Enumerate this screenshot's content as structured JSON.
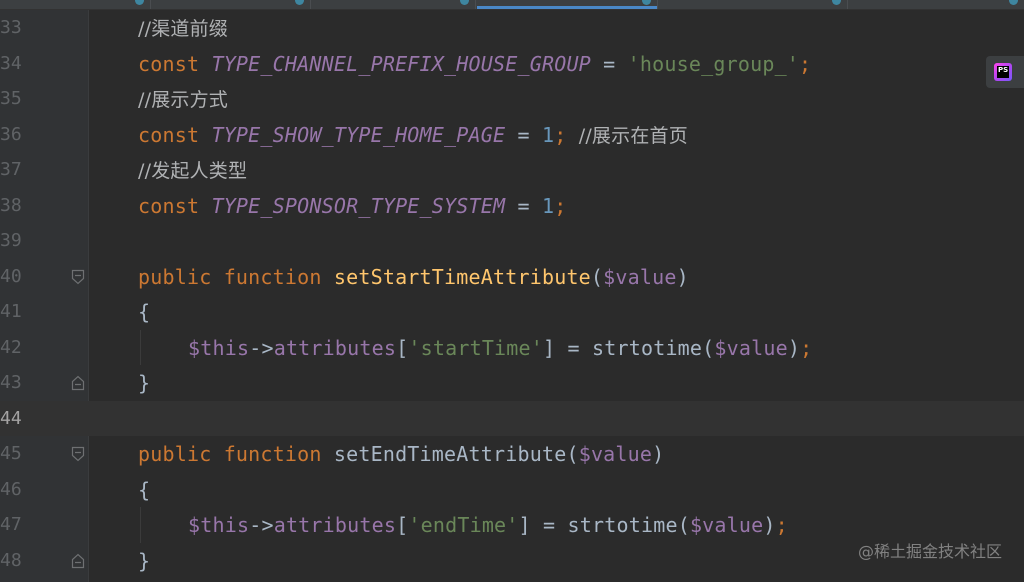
{
  "editor": {
    "lines": [
      {
        "num": "33",
        "fold": "",
        "current": false,
        "indent": 1,
        "tokens": [
          {
            "t": "//渠道前缀",
            "c": "comment"
          }
        ]
      },
      {
        "num": "34",
        "fold": "",
        "current": false,
        "indent": 1,
        "tokens": [
          {
            "t": "const ",
            "c": "kw"
          },
          {
            "t": "TYPE_CHANNEL_PREFIX_HOUSE_GROUP",
            "c": "const-name"
          },
          {
            "t": " = ",
            "c": "op"
          },
          {
            "t": "'house_group_'",
            "c": "str"
          },
          {
            "t": ";",
            "c": "semi"
          }
        ]
      },
      {
        "num": "35",
        "fold": "",
        "current": false,
        "indent": 1,
        "tokens": [
          {
            "t": "//展示方式",
            "c": "comment"
          }
        ]
      },
      {
        "num": "36",
        "fold": "",
        "current": false,
        "indent": 1,
        "tokens": [
          {
            "t": "const ",
            "c": "kw"
          },
          {
            "t": "TYPE_SHOW_TYPE_HOME_PAGE",
            "c": "const-name"
          },
          {
            "t": " = ",
            "c": "op"
          },
          {
            "t": "1",
            "c": "num"
          },
          {
            "t": "; ",
            "c": "semi"
          },
          {
            "t": "//展示在首页",
            "c": "comment"
          }
        ]
      },
      {
        "num": "37",
        "fold": "",
        "current": false,
        "indent": 1,
        "tokens": [
          {
            "t": "//发起人类型",
            "c": "comment"
          }
        ]
      },
      {
        "num": "38",
        "fold": "",
        "current": false,
        "indent": 1,
        "tokens": [
          {
            "t": "const ",
            "c": "kw"
          },
          {
            "t": "TYPE_SPONSOR_TYPE_SYSTEM",
            "c": "const-name"
          },
          {
            "t": " = ",
            "c": "op"
          },
          {
            "t": "1",
            "c": "num"
          },
          {
            "t": ";",
            "c": "semi"
          }
        ]
      },
      {
        "num": "39",
        "fold": "",
        "current": false,
        "indent": 1,
        "tokens": []
      },
      {
        "num": "40",
        "fold": "open",
        "current": false,
        "indent": 1,
        "tokens": [
          {
            "t": "public ",
            "c": "kw"
          },
          {
            "t": "function ",
            "c": "kw"
          },
          {
            "t": "setStartTimeAttribute",
            "c": "fn-decl"
          },
          {
            "t": "(",
            "c": "op"
          },
          {
            "t": "$value",
            "c": "var"
          },
          {
            "t": ")",
            "c": "op"
          }
        ]
      },
      {
        "num": "41",
        "fold": "",
        "current": false,
        "indent": 1,
        "tokens": [
          {
            "t": "{",
            "c": "brace"
          }
        ]
      },
      {
        "num": "42",
        "fold": "",
        "current": false,
        "indent": 2,
        "tokens": [
          {
            "t": "$this",
            "c": "var"
          },
          {
            "t": "->",
            "c": "op"
          },
          {
            "t": "attributes",
            "c": "var"
          },
          {
            "t": "[",
            "c": "op"
          },
          {
            "t": "'startTime'",
            "c": "str"
          },
          {
            "t": "] = ",
            "c": "op"
          },
          {
            "t": "strtotime",
            "c": "fn-call"
          },
          {
            "t": "(",
            "c": "op"
          },
          {
            "t": "$value",
            "c": "var"
          },
          {
            "t": ")",
            "c": "op"
          },
          {
            "t": ";",
            "c": "semi"
          }
        ]
      },
      {
        "num": "43",
        "fold": "close",
        "current": false,
        "indent": 1,
        "tokens": [
          {
            "t": "}",
            "c": "brace"
          }
        ]
      },
      {
        "num": "44",
        "fold": "",
        "current": true,
        "indent": 1,
        "tokens": []
      },
      {
        "num": "45",
        "fold": "open",
        "current": false,
        "indent": 1,
        "tokens": [
          {
            "t": "public ",
            "c": "kw"
          },
          {
            "t": "function ",
            "c": "kw"
          },
          {
            "t": "setEndTimeAttribute",
            "c": "fn-decl-unused"
          },
          {
            "t": "(",
            "c": "op"
          },
          {
            "t": "$value",
            "c": "var"
          },
          {
            "t": ")",
            "c": "op"
          }
        ]
      },
      {
        "num": "46",
        "fold": "",
        "current": false,
        "indent": 1,
        "tokens": [
          {
            "t": "{",
            "c": "brace"
          }
        ]
      },
      {
        "num": "47",
        "fold": "",
        "current": false,
        "indent": 2,
        "tokens": [
          {
            "t": "$this",
            "c": "var"
          },
          {
            "t": "->",
            "c": "op"
          },
          {
            "t": "attributes",
            "c": "var"
          },
          {
            "t": "[",
            "c": "op"
          },
          {
            "t": "'endTime'",
            "c": "str"
          },
          {
            "t": "] = ",
            "c": "op"
          },
          {
            "t": "strtotime",
            "c": "fn-call"
          },
          {
            "t": "(",
            "c": "op"
          },
          {
            "t": "$value",
            "c": "var"
          },
          {
            "t": ")",
            "c": "op"
          },
          {
            "t": ";",
            "c": "semi"
          }
        ]
      },
      {
        "num": "48",
        "fold": "close",
        "current": false,
        "indent": 1,
        "tokens": [
          {
            "t": "}",
            "c": "brace"
          }
        ]
      }
    ]
  },
  "plugin_badge": {
    "icon": "phpstorm-icon",
    "label": "PS"
  },
  "watermark": {
    "text": "@稀土掘金技术社区"
  },
  "colors": {
    "background": "#2b2b2b",
    "gutter": "#313335",
    "keyword": "#cc7832",
    "constant": "#9876aa",
    "string": "#6a8759",
    "number": "#6897bb",
    "function": "#ffc66d",
    "plain": "#a9b7c6",
    "comment": "#b0b2b4"
  }
}
